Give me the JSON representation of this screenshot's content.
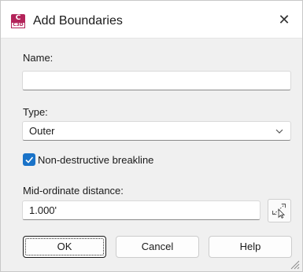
{
  "window": {
    "title": "Add Boundaries",
    "app_icon": {
      "name": "civil3d-app-icon",
      "letter": "C",
      "badge": "C3D",
      "color": "#b3245a"
    },
    "close_icon": "close-icon"
  },
  "name_field": {
    "label": "Name:",
    "value": ""
  },
  "type_field": {
    "label": "Type:",
    "selected": "Outer"
  },
  "non_destructive": {
    "label": "Non-destructive breakline",
    "checked": true
  },
  "mid_ordinate": {
    "label": "Mid-ordinate distance:",
    "value": "1.000'",
    "pick_icon": "pick-distance-icon"
  },
  "buttons": {
    "ok": "OK",
    "cancel": "Cancel",
    "help": "Help"
  },
  "colors": {
    "accent": "#1a73c8",
    "app_brand": "#b3245a"
  }
}
